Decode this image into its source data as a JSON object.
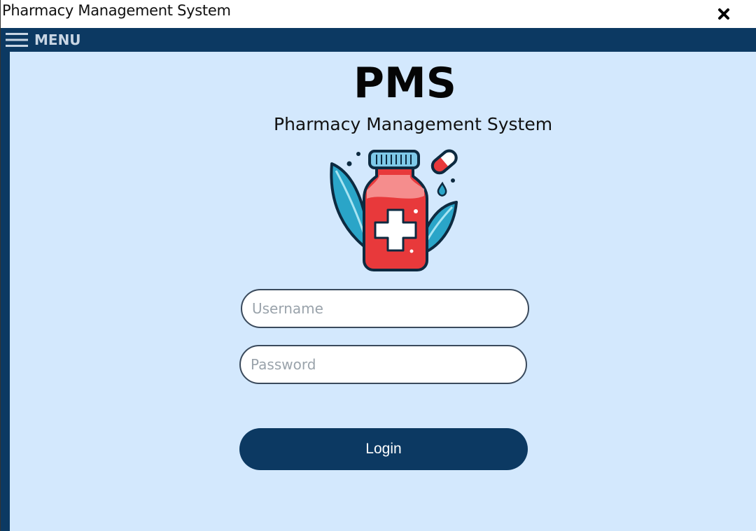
{
  "window": {
    "title": "Pharmacy Management System",
    "close_icon": "close-icon"
  },
  "menu": {
    "label": "MENU",
    "icon": "hamburger-icon"
  },
  "login": {
    "app_abbrev": "PMS",
    "app_name": "Pharmacy Management System",
    "logo_icon": "medicine-bottle-logo",
    "username_placeholder": "Username",
    "username_value": "",
    "password_placeholder": "Password",
    "password_value": "",
    "login_label": "Login"
  },
  "colors": {
    "navy": "#0c3962",
    "background": "#d3e8fd",
    "bottle_red": "#e8393b",
    "leaf_teal": "#2aa5c8"
  }
}
